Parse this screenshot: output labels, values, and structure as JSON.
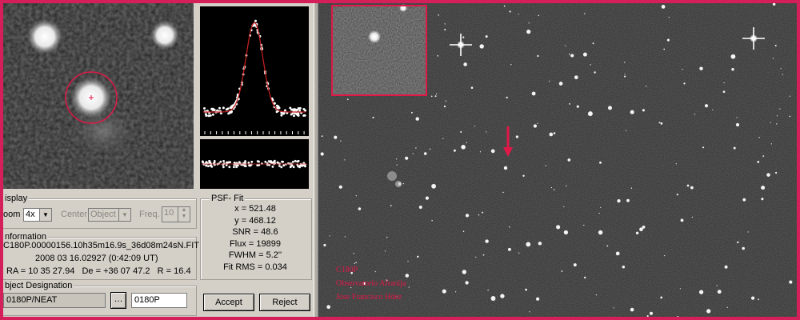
{
  "display": {
    "legend": "isplay",
    "zoom_label": "oom",
    "zoom_value": "4x",
    "center_label": "Center",
    "center_value": "Object",
    "freq_label": "Freq.",
    "freq_value": "10"
  },
  "information": {
    "legend": "nformation",
    "filename": "C180P.00000156.10h35m16.9s_36d08m24sN.FIT",
    "date": "2008 03 16.02927 (0:42:09 UT)",
    "coords": "RA = 10 35 27.94   De = +36 07 47.2   R = 16.4"
  },
  "designation": {
    "legend": "bject Designation",
    "value": "0180P/NEAT",
    "browse_label": "…",
    "short": "0180P"
  },
  "psf": {
    "legend": "PSF- Fit",
    "lines": [
      "x = 521.48",
      "y = 468.12",
      "SNR = 48.6",
      "Flux = 19899",
      "FWHM = 5.2''",
      "Fit RMS = 0.034"
    ]
  },
  "buttons": {
    "accept": "Accept",
    "reject": "Reject"
  },
  "caption": {
    "lines": [
      "C180P",
      "Observatorio Afranija",
      "Jose Francisco Hdez"
    ]
  },
  "colors": {
    "border": "#d51f5a",
    "marker": "#e01848",
    "fit_line": "#cc2020"
  }
}
